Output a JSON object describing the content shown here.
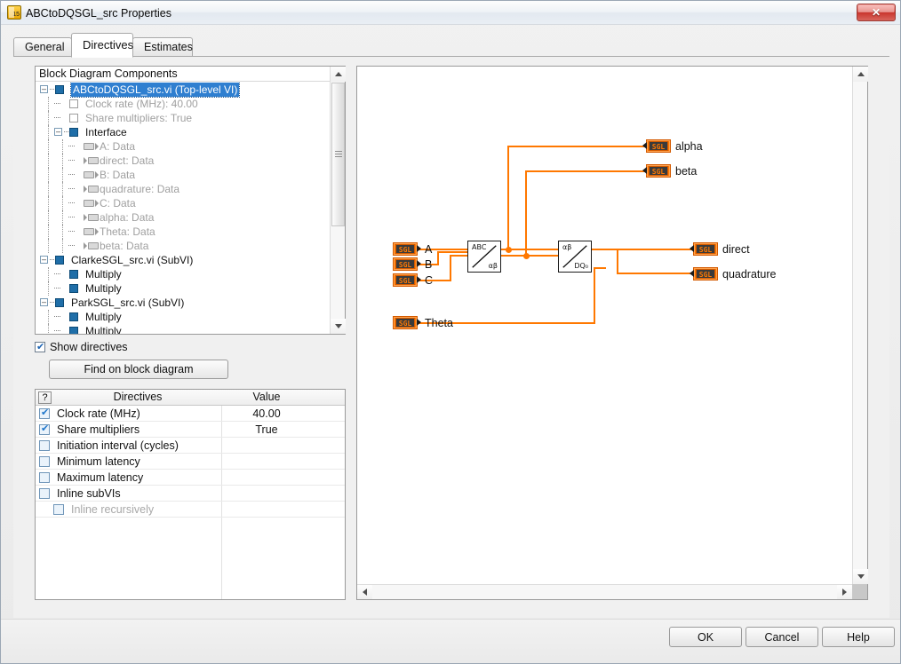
{
  "window": {
    "title": "ABCtoDQSGL_src Properties",
    "icon": "labview-vi-icon",
    "close_label": "✕"
  },
  "tabs": [
    {
      "label": "General",
      "active": false
    },
    {
      "label": "Directives",
      "active": true
    },
    {
      "label": "Estimates",
      "active": false
    }
  ],
  "tree": {
    "header": "Block Diagram Components",
    "nodes": [
      {
        "label": "ABCtoDQSGL_src.vi (Top-level VI)",
        "depth": 0,
        "icon": "filled-square-icon",
        "expander": "minus",
        "selected": true,
        "dim": false
      },
      {
        "label": "Clock rate (MHz): 40.00",
        "depth": 1,
        "icon": "hollow-square-icon",
        "expander": "none",
        "selected": false,
        "dim": true
      },
      {
        "label": "Share multipliers: True",
        "depth": 1,
        "icon": "hollow-square-icon",
        "expander": "none",
        "selected": false,
        "dim": true
      },
      {
        "label": "Interface",
        "depth": 1,
        "icon": "filled-square-icon",
        "expander": "minus",
        "selected": false,
        "dim": false
      },
      {
        "label": "A: Data",
        "depth": 2,
        "icon": "control-terminal-icon",
        "expander": "none",
        "selected": false,
        "dim": true
      },
      {
        "label": "direct: Data",
        "depth": 2,
        "icon": "indicator-terminal-icon",
        "expander": "none",
        "selected": false,
        "dim": true
      },
      {
        "label": "B: Data",
        "depth": 2,
        "icon": "control-terminal-icon",
        "expander": "none",
        "selected": false,
        "dim": true
      },
      {
        "label": "quadrature: Data",
        "depth": 2,
        "icon": "indicator-terminal-icon",
        "expander": "none",
        "selected": false,
        "dim": true
      },
      {
        "label": "C: Data",
        "depth": 2,
        "icon": "control-terminal-icon",
        "expander": "none",
        "selected": false,
        "dim": true
      },
      {
        "label": "alpha: Data",
        "depth": 2,
        "icon": "indicator-terminal-icon",
        "expander": "none",
        "selected": false,
        "dim": true
      },
      {
        "label": "Theta: Data",
        "depth": 2,
        "icon": "control-terminal-icon",
        "expander": "none",
        "selected": false,
        "dim": true
      },
      {
        "label": "beta: Data",
        "depth": 2,
        "icon": "indicator-terminal-icon",
        "expander": "none",
        "selected": false,
        "dim": true
      },
      {
        "label": "ClarkeSGL_src.vi (SubVI)",
        "depth": 0,
        "icon": "filled-square-icon",
        "expander": "minus",
        "selected": false,
        "dim": false
      },
      {
        "label": "Multiply",
        "depth": 1,
        "icon": "filled-square-icon",
        "expander": "none",
        "selected": false,
        "dim": false
      },
      {
        "label": "Multiply",
        "depth": 1,
        "icon": "filled-square-icon",
        "expander": "none",
        "selected": false,
        "dim": false
      },
      {
        "label": "ParkSGL_src.vi (SubVI)",
        "depth": 0,
        "icon": "filled-square-icon",
        "expander": "minus",
        "selected": false,
        "dim": false
      },
      {
        "label": "Multiply",
        "depth": 1,
        "icon": "filled-square-icon",
        "expander": "none",
        "selected": false,
        "dim": false
      },
      {
        "label": "Multiply",
        "depth": 1,
        "icon": "filled-square-icon",
        "expander": "none",
        "selected": false,
        "dim": false
      }
    ],
    "scrollbar": {
      "up_icon": "scroll-up-icon",
      "down_icon": "scroll-down-icon"
    }
  },
  "show_directives": {
    "label": "Show directives",
    "checked": true
  },
  "find_button": {
    "label": "Find on block diagram"
  },
  "grid": {
    "help_button": "?",
    "columns": [
      "Directives",
      "Value"
    ],
    "rows": [
      {
        "name": "Clock rate (MHz)",
        "value": "40.00",
        "checked": true,
        "enabled": true,
        "indent": false
      },
      {
        "name": "Share multipliers",
        "value": "True",
        "checked": true,
        "enabled": true,
        "indent": false
      },
      {
        "name": "Initiation interval (cycles)",
        "value": "",
        "checked": false,
        "enabled": true,
        "indent": false
      },
      {
        "name": "Minimum latency",
        "value": "",
        "checked": false,
        "enabled": true,
        "indent": false
      },
      {
        "name": "Maximum latency",
        "value": "",
        "checked": false,
        "enabled": true,
        "indent": false
      },
      {
        "name": "Inline subVIs",
        "value": "",
        "checked": false,
        "enabled": true,
        "indent": false
      },
      {
        "name": "Inline recursively",
        "value": "",
        "checked": false,
        "enabled": false,
        "indent": true
      }
    ]
  },
  "diagram": {
    "inputs": [
      {
        "label": "A",
        "type": "SGL"
      },
      {
        "label": "B",
        "type": "SGL"
      },
      {
        "label": "C",
        "type": "SGL"
      },
      {
        "label": "Theta",
        "type": "SGL"
      }
    ],
    "outputs": [
      {
        "label": "alpha",
        "type": "SGL"
      },
      {
        "label": "beta",
        "type": "SGL"
      },
      {
        "label": "direct",
        "type": "SGL"
      },
      {
        "label": "quadrature",
        "type": "SGL"
      }
    ],
    "functions": [
      {
        "name": "clarke-transform-node",
        "top_left": "ABC",
        "bottom_right": "αβ"
      },
      {
        "name": "park-transform-node",
        "top_left": "αβ",
        "bottom_right": "DQ₀"
      }
    ],
    "wire_color": "#ff7800"
  },
  "footer": {
    "ok": "OK",
    "cancel": "Cancel",
    "help": "Help"
  }
}
